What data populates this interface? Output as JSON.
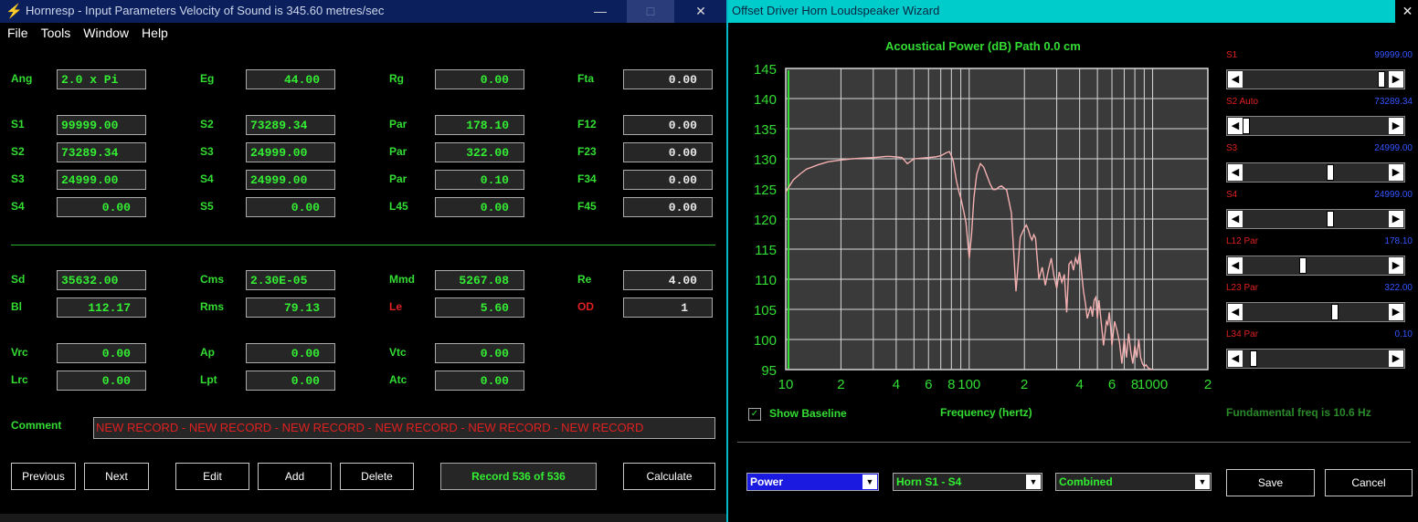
{
  "left_window": {
    "title": "Hornresp - Input Parameters   Velocity of Sound is 345.60 metres/sec",
    "minimize": "—",
    "maximize": "□",
    "close": "✕",
    "menu": [
      "File",
      "Tools",
      "Window",
      "Help"
    ],
    "fields": {
      "ang": {
        "label": "Ang",
        "value": "2.0 x Pi"
      },
      "eg": {
        "label": "Eg",
        "value": "44.00"
      },
      "rg": {
        "label": "Rg",
        "value": "0.00"
      },
      "fta": {
        "label": "Fta",
        "value": "0.00"
      },
      "s1": {
        "label": "S1",
        "value": "99999.00"
      },
      "s2_r2": {
        "label": "S2",
        "value": "73289.34"
      },
      "par1": {
        "label": "Par",
        "value": "178.10"
      },
      "f12": {
        "label": "F12",
        "value": "0.00"
      },
      "s2": {
        "label": "S2",
        "value": "73289.34"
      },
      "s3_r3": {
        "label": "S3",
        "value": "24999.00"
      },
      "par2": {
        "label": "Par",
        "value": "322.00"
      },
      "f23": {
        "label": "F23",
        "value": "0.00"
      },
      "s3": {
        "label": "S3",
        "value": "24999.00"
      },
      "s4_r4": {
        "label": "S4",
        "value": "24999.00"
      },
      "par3": {
        "label": "Par",
        "value": "0.10"
      },
      "f34": {
        "label": "F34",
        "value": "0.00"
      },
      "s4": {
        "label": "S4",
        "value": "0.00"
      },
      "s5": {
        "label": "S5",
        "value": "0.00"
      },
      "l45": {
        "label": "L45",
        "value": "0.00"
      },
      "f45": {
        "label": "F45",
        "value": "0.00"
      },
      "sd": {
        "label": "Sd",
        "value": "35632.00"
      },
      "cms": {
        "label": "Cms",
        "value": "2.30E-05"
      },
      "mmd": {
        "label": "Mmd",
        "value": "5267.08"
      },
      "re": {
        "label": "Re",
        "value": "4.00"
      },
      "bl": {
        "label": "Bl",
        "value": "112.17"
      },
      "rms": {
        "label": "Rms",
        "value": "79.13"
      },
      "le": {
        "label": "Le",
        "value": "5.60"
      },
      "od": {
        "label": "OD",
        "value": "1"
      },
      "vrc": {
        "label": "Vrc",
        "value": "0.00"
      },
      "ap": {
        "label": "Ap",
        "value": "0.00"
      },
      "vtc": {
        "label": "Vtc",
        "value": "0.00"
      },
      "lrc": {
        "label": "Lrc",
        "value": "0.00"
      },
      "lpt": {
        "label": "Lpt",
        "value": "0.00"
      },
      "atc": {
        "label": "Atc",
        "value": "0.00"
      }
    },
    "comment_label": "Comment",
    "comment_value": "NEW RECORD - NEW RECORD - NEW RECORD - NEW RECORD - NEW RECORD - NEW RECORD",
    "buttons": {
      "previous": "Previous",
      "next": "Next",
      "edit": "Edit",
      "add": "Add",
      "delete": "Delete",
      "calculate": "Calculate"
    },
    "record": "Record 536 of 536"
  },
  "right_window": {
    "title": "Offset Driver Horn Loudspeaker Wizard",
    "close": "✕",
    "chart_title": "Acoustical Power (dB)   Path 0.0 cm",
    "sliders": [
      {
        "name": "S1",
        "value": "99999.00",
        "pos": 0.96
      },
      {
        "name": "S2 Auto",
        "value": "73289.34",
        "pos": 0.0
      },
      {
        "name": "S3",
        "value": "24999.00",
        "pos": 0.6
      },
      {
        "name": "S4",
        "value": "24999.00",
        "pos": 0.6
      },
      {
        "name": "L12 Par",
        "value": "178.10",
        "pos": 0.4
      },
      {
        "name": "L23 Par",
        "value": "322.00",
        "pos": 0.63
      },
      {
        "name": "L34 Par",
        "value": "0.10",
        "pos": 0.05
      }
    ],
    "show_baseline": "Show Baseline",
    "show_baseline_checked": "✓",
    "x_axis_label": "Frequency (hertz)",
    "fundamental": "Fundamental freq is 10.6 Hz",
    "combos": {
      "c1": "Power",
      "c2": "Horn S1 - S4",
      "c3": "Combined"
    },
    "save": "Save",
    "cancel": "Cancel"
  },
  "chart_data": {
    "type": "line",
    "title": "Acoustical Power (dB)   Path 0.0 cm",
    "xlabel": "Frequency (hertz)",
    "ylabel": "",
    "x_scale": "log",
    "xlim": [
      10,
      2000
    ],
    "ylim": [
      95,
      145
    ],
    "x_ticks": [
      10,
      20,
      40,
      60,
      80,
      100,
      200,
      400,
      600,
      800,
      1000,
      2000
    ],
    "x_tick_labels": [
      "10",
      "2",
      "4",
      "6",
      "8",
      "100",
      "2",
      "4",
      "6",
      "8",
      "1000",
      "2"
    ],
    "y_ticks": [
      95,
      100,
      105,
      110,
      115,
      120,
      125,
      130,
      135,
      140,
      145
    ],
    "grid": true,
    "line_color": "#f4b0b0",
    "baseline_color": "#33dd33",
    "series": [
      {
        "x": [
          10,
          11,
          12,
          13,
          15,
          17,
          20,
          23,
          26,
          30,
          33,
          35,
          37,
          40,
          43,
          46,
          50,
          55,
          60,
          65,
          70,
          75,
          78,
          80,
          82,
          85,
          88,
          90,
          93,
          96,
          100,
          103,
          106,
          110,
          115,
          120,
          125,
          130,
          135,
          140,
          145,
          150,
          160,
          170,
          180,
          190,
          200,
          205,
          210,
          215,
          220,
          225,
          230,
          240,
          250,
          260,
          270,
          280,
          290,
          300,
          310,
          320,
          330,
          340,
          350,
          360,
          370,
          380,
          390,
          400,
          410,
          420,
          430,
          440,
          450,
          460,
          470,
          480,
          490,
          500,
          510,
          520,
          530,
          540,
          550,
          560,
          570,
          580,
          590,
          600,
          620,
          640,
          660,
          680,
          700,
          720,
          740,
          760,
          780,
          800,
          820,
          840,
          860,
          880,
          900,
          920,
          950,
          1000
        ],
        "y": [
          124.5,
          126.5,
          127.5,
          128.3,
          129,
          129.5,
          129.8,
          130,
          130.1,
          130.2,
          130.3,
          130.4,
          130.4,
          130.3,
          130.2,
          129.2,
          130,
          130.1,
          130.2,
          130.3,
          130.5,
          131,
          131.2,
          130.5,
          129.5,
          126.5,
          124.5,
          123.5,
          121.5,
          119.5,
          113.5,
          117.5,
          123.5,
          127.5,
          129.2,
          128.6,
          127.2,
          125.8,
          124.9,
          124.9,
          125.3,
          125.5,
          124.8,
          121,
          108,
          117,
          118.5,
          119,
          118.2,
          117.2,
          116.5,
          117.4,
          116.8,
          110,
          112,
          109,
          111.5,
          113.5,
          110.5,
          108.5,
          111.2,
          109.5,
          110.8,
          104.5,
          112.5,
          113,
          111.5,
          113.5,
          112.5,
          114.5,
          111,
          108,
          106,
          103.5,
          104.5,
          105.5,
          103.8,
          106.5,
          107,
          103.5,
          106.5,
          104,
          101.5,
          99,
          101,
          103,
          102.5,
          104.5,
          102,
          99,
          103,
          101.5,
          99.5,
          96,
          100,
          97,
          101,
          98,
          96,
          99,
          97,
          100,
          97,
          96,
          95.5,
          95.8,
          95.2,
          95
        ]
      }
    ]
  }
}
